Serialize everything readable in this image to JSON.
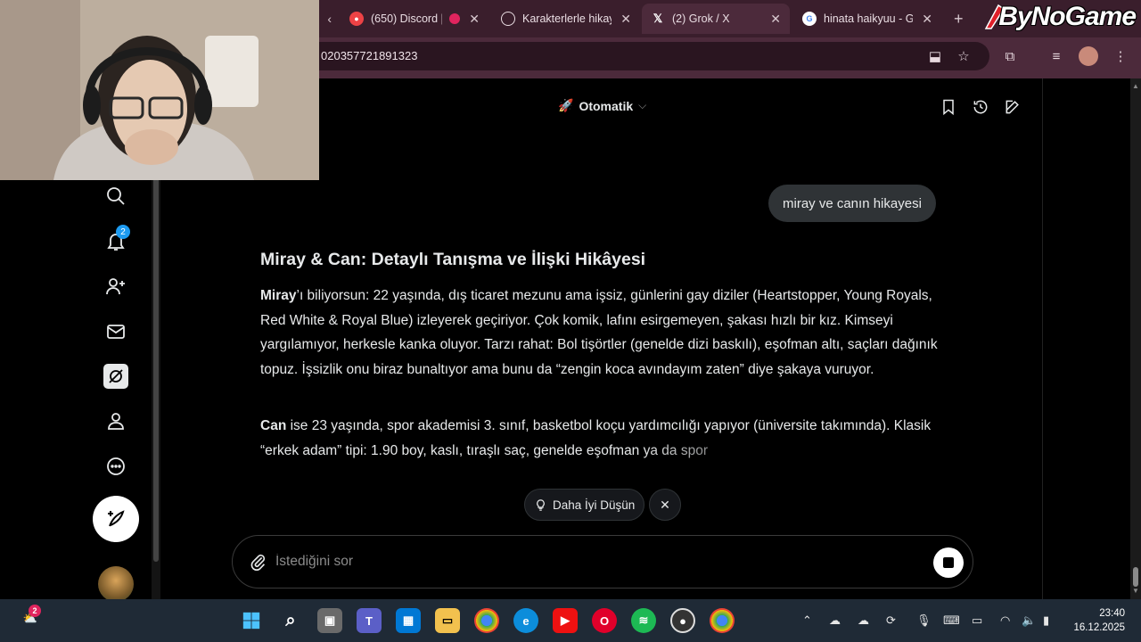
{
  "browser": {
    "tabs": [
      {
        "title": "",
        "active": false
      },
      {
        "title": "(650) Discord |",
        "badge": "650",
        "active": false
      },
      {
        "title": "Karakterlerle hikay",
        "active": false
      },
      {
        "title": "(2) Grok / X",
        "active": true
      },
      {
        "title": "hinata haikyuu - G",
        "active": false
      }
    ],
    "address": "020357721891323",
    "brand": "ByNoGame"
  },
  "sidebar": {
    "notification_count": "2",
    "items": [
      "search-icon",
      "bell-icon",
      "person-add-icon",
      "mail-icon",
      "grok-icon",
      "profile-icon",
      "more-icon"
    ]
  },
  "grok": {
    "mode_label": "Otomatik",
    "user_message": "miray ve canın hikayesi",
    "answer_title": "Miray & Can: Detaylı Tanışma ve İlişki Hikâyesi",
    "p1_name": "Miray",
    "p1_text": "’ı biliyorsun: 22 yaşında, dış ticaret mezunu ama işsiz, günlerini gay diziler (Heartstopper, Young Royals, Red White & Royal Blue) izleyerek geçiriyor. Çok komik, lafını esirgemeyen, şakası hızlı bir kız. Kimseyi yargılamıyor, herkesle kanka oluyor. Tarzı rahat: Bol tişörtler (genelde dizi baskılı), eşofman altı, saçları dağınık topuz. İşsizlik onu biraz bunaltıyor ama bunu da “zengin koca avındayım zaten” diye şakaya vuruyor.",
    "p2_name": "Can",
    "p2_text": " ise 23 yaşında, spor akademisi 3. sınıf, basketbol koçu yardımcılığı yapıyor (üniversite takımında). Klasik “erkek adam” tipi: 1.90 boy, kaslı, tıraşlı saç, genelde eşofman ya da spor",
    "think_label": "Daha İyi Düşün",
    "composer_placeholder": "İstediğini sor"
  },
  "taskbar": {
    "weather_badge": "2",
    "time": "23:40",
    "date": "16.12.2025"
  },
  "colors": {
    "accent": "#1d9bf0",
    "tabstrip": "#3a1e2c",
    "toolbar": "#4c2a3b"
  }
}
